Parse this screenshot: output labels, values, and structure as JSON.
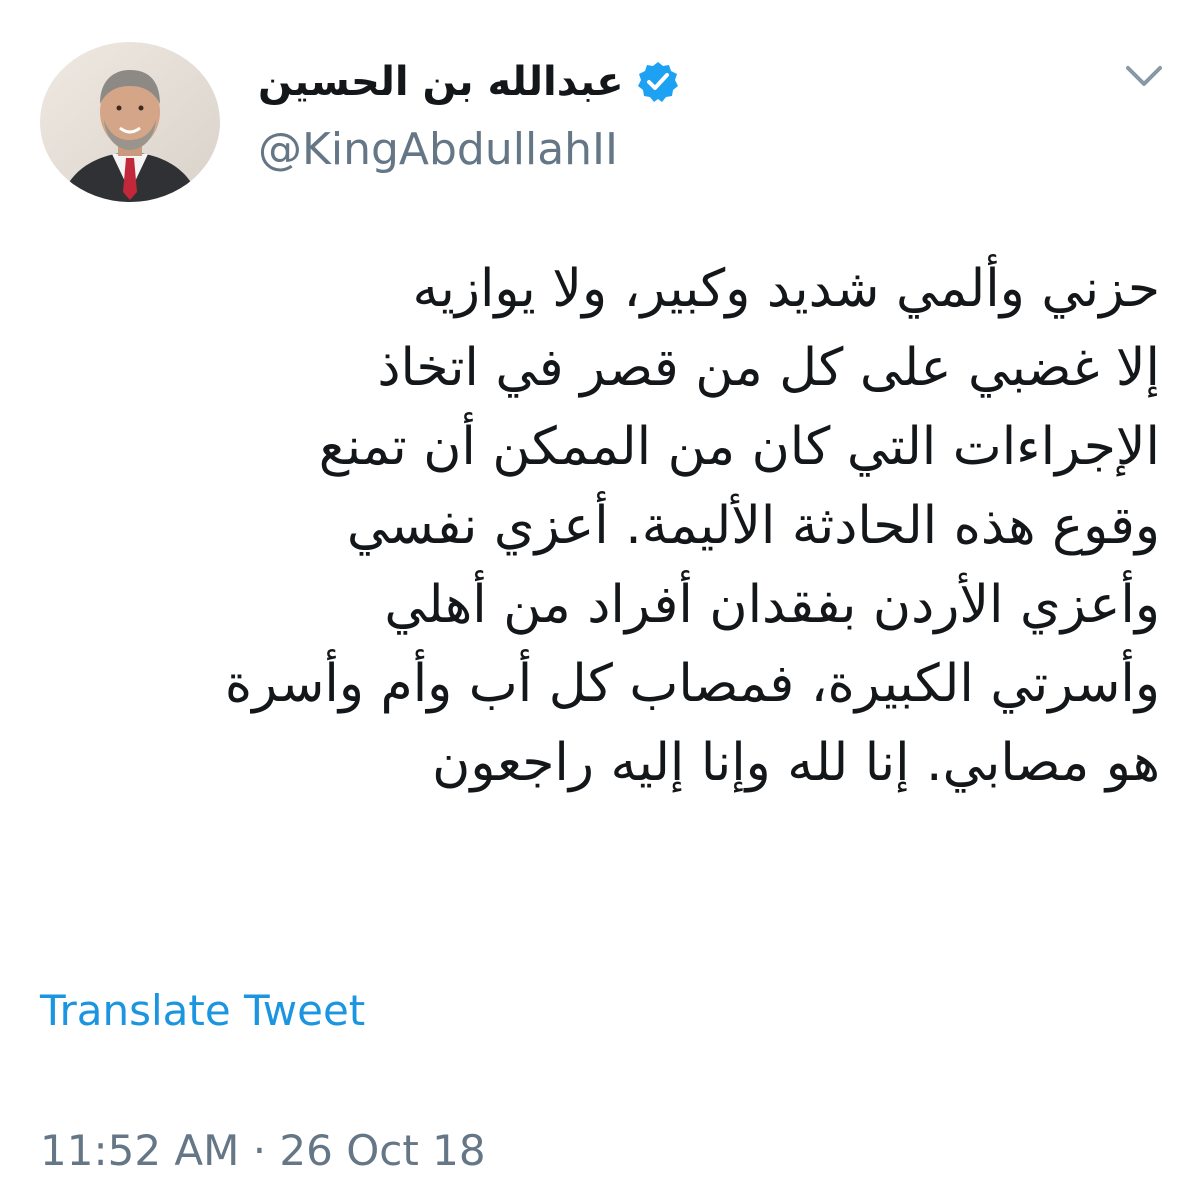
{
  "author": {
    "display_name": "عبدالله بن الحسين",
    "handle": "@KingAbdullahII",
    "verified": true,
    "avatar_icon": "profile-photo"
  },
  "tweet": {
    "lines": [
      "حزني وألمي شديد وكبير، ولا يوازيه",
      "إلا غضبي على كل من قصر في اتخاذ",
      "الإجراءات التي كان من الممكن أن تمنع",
      "وقوع هذه الحادثة الأليمة. أعزي نفسي",
      "وأعزي الأردن بفقدان أفراد من أهلي",
      "وأسرتي الكبيرة، فمصاب كل أب وأم وأسرة",
      "هو مصابي. إنا لله وإنا إليه راجعون"
    ],
    "translate_label": "Translate Tweet",
    "timestamp": "11:52 AM · 26 Oct 18"
  },
  "colors": {
    "text": "#14171a",
    "secondary": "#657786",
    "link": "#1b95e0",
    "verified": "#1da1f2"
  },
  "icons": {
    "verified": "verified-badge-icon",
    "menu": "chevron-down-icon"
  }
}
